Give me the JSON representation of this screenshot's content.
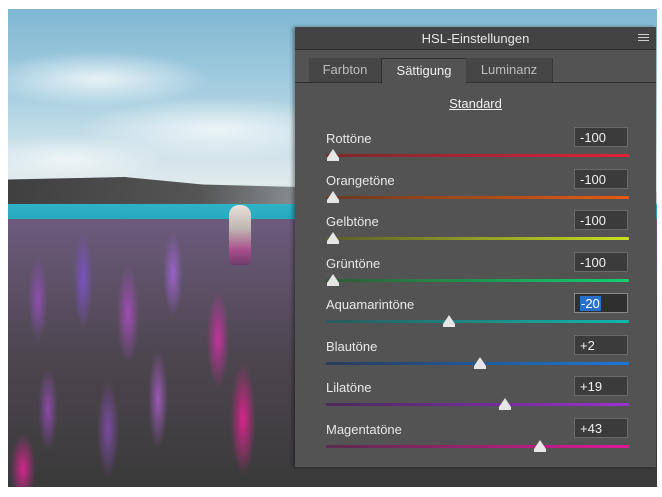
{
  "panel": {
    "title": "HSL-Einstellungen",
    "tabs": [
      {
        "label": "Farbton",
        "active": false
      },
      {
        "label": "Sättigung",
        "active": true
      },
      {
        "label": "Luminanz",
        "active": false
      }
    ],
    "preset": "Standard",
    "sliders": [
      {
        "label": "Rottöne",
        "value": "-100",
        "level": 0.0,
        "colors": [
          "#7a2a2a",
          "#e0203c"
        ]
      },
      {
        "label": "Orangetöne",
        "value": "-100",
        "level": 0.0,
        "colors": [
          "#6a3a20",
          "#e85a10"
        ]
      },
      {
        "label": "Gelbtöne",
        "value": "-100",
        "level": 0.0,
        "colors": [
          "#5a5a2a",
          "#c8e020"
        ]
      },
      {
        "label": "Grüntöne",
        "value": "-100",
        "level": 0.0,
        "colors": [
          "#2f5a35",
          "#10d070"
        ]
      },
      {
        "label": "Aquamarintöne",
        "value": "-20",
        "level": 0.4,
        "colors": [
          "#2a5a5a",
          "#10b8b0"
        ],
        "focused": true
      },
      {
        "label": "Blautöne",
        "value": "+2",
        "level": 0.51,
        "colors": [
          "#2a3a5a",
          "#1a78d8"
        ]
      },
      {
        "label": "Lilatöne",
        "value": "+19",
        "level": 0.595,
        "colors": [
          "#4a2a5a",
          "#9a30d0"
        ]
      },
      {
        "label": "Magentatöne",
        "value": "+43",
        "level": 0.715,
        "colors": [
          "#5a2a4a",
          "#e0189a"
        ]
      }
    ]
  }
}
